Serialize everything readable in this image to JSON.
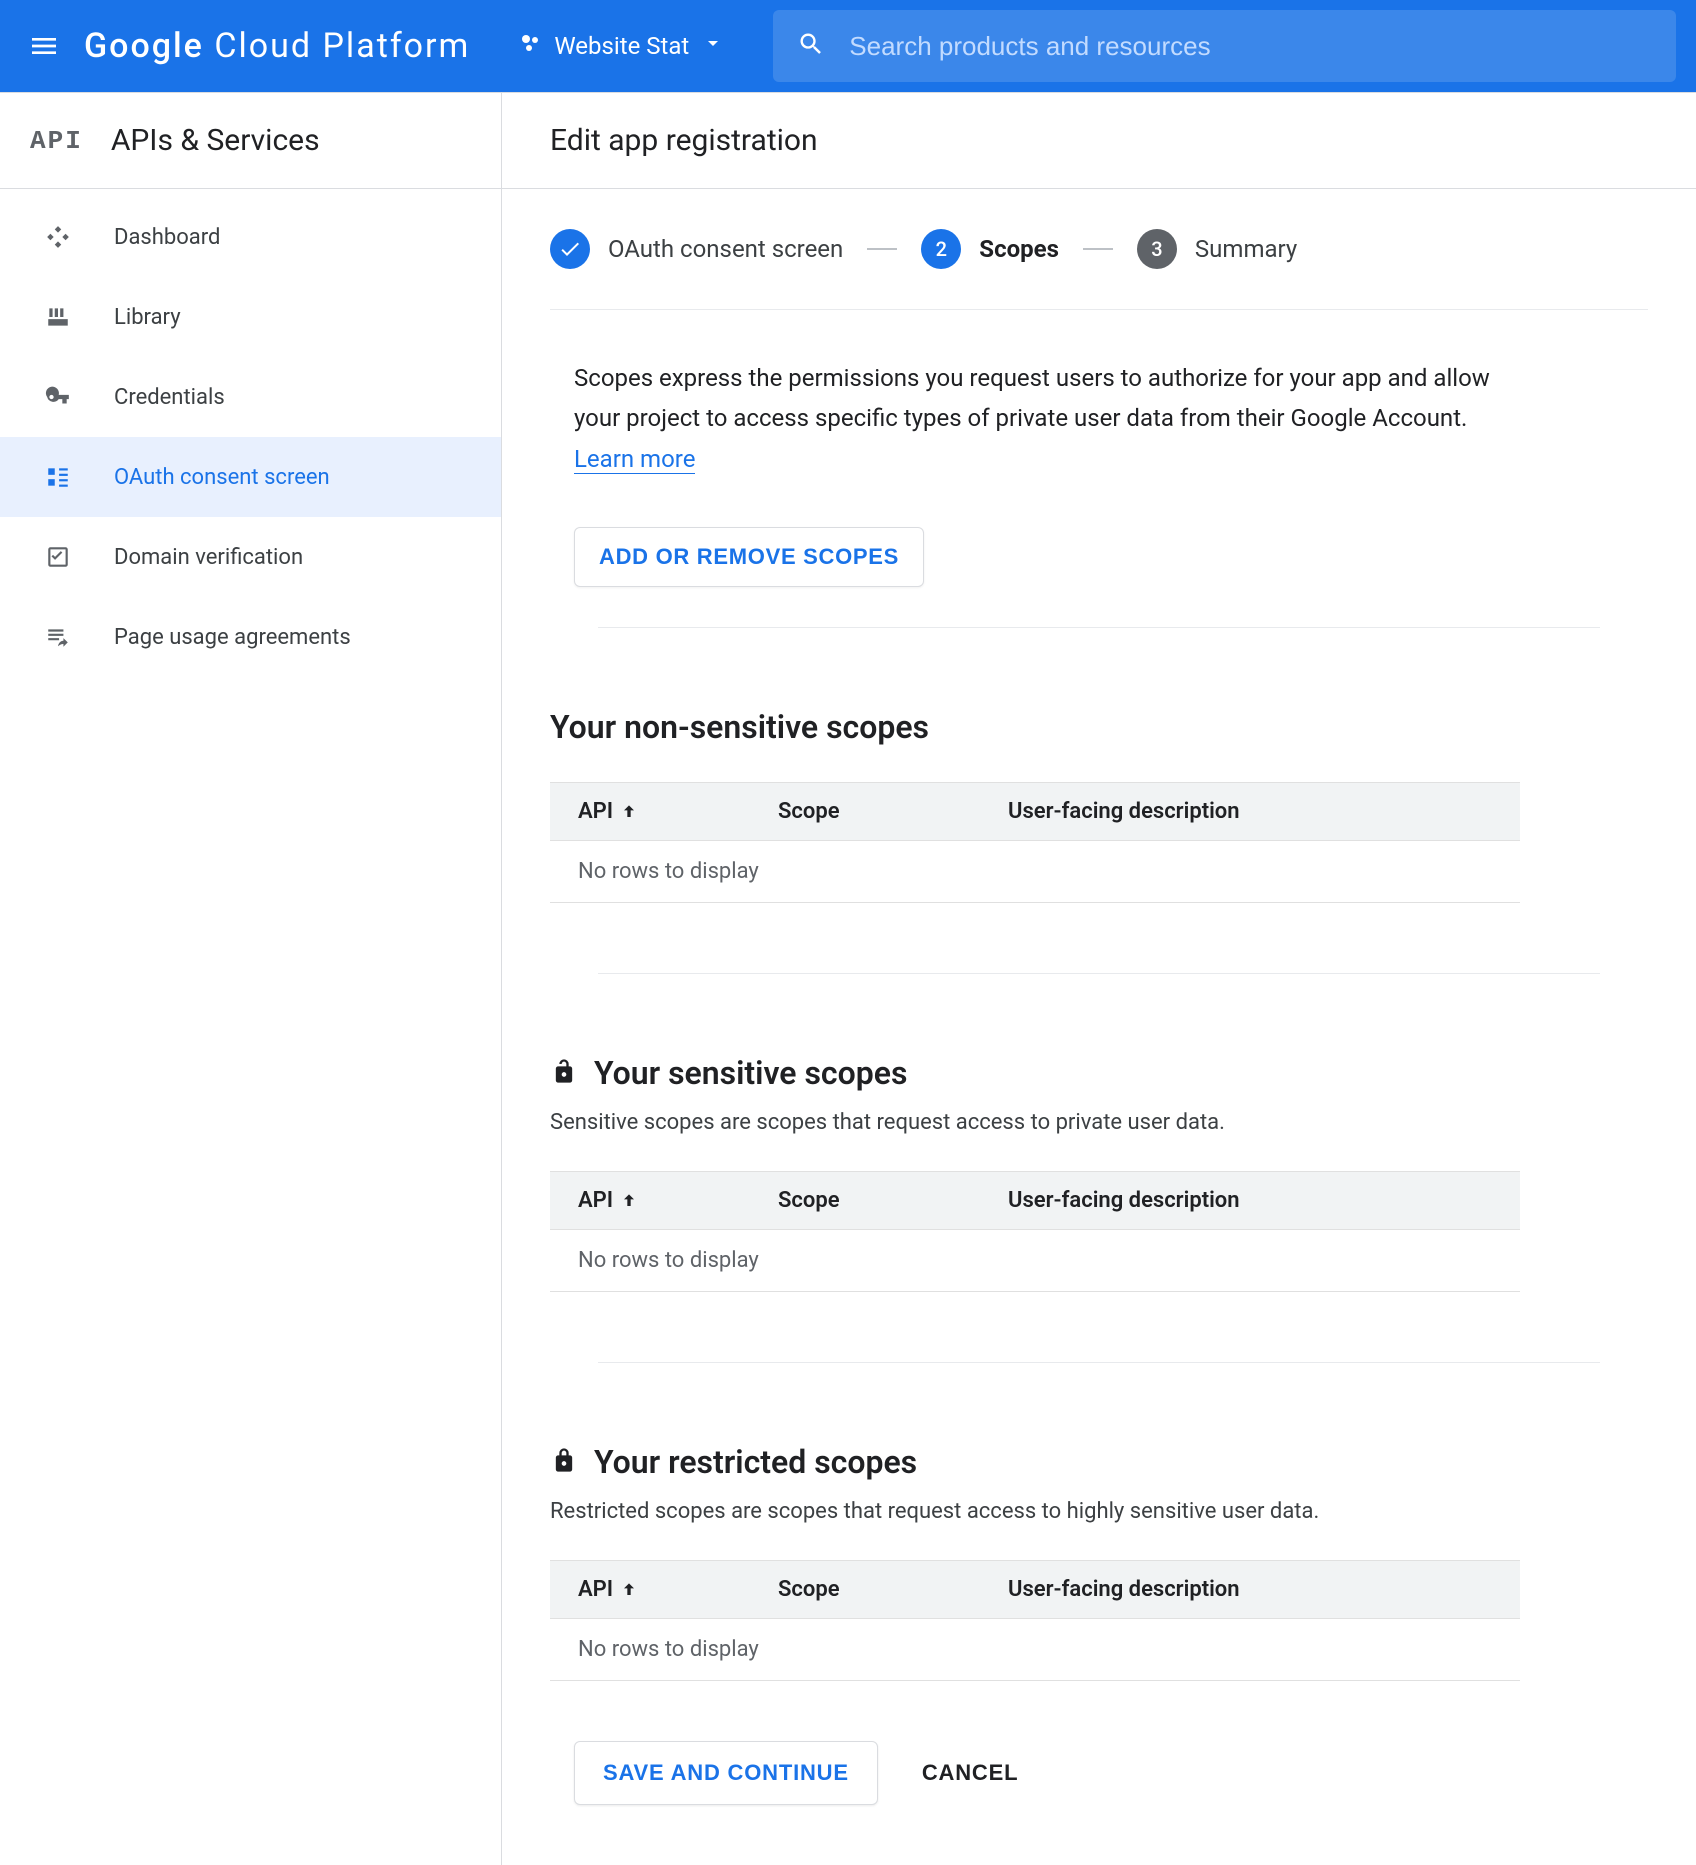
{
  "header": {
    "brand_prefix": "Google",
    "brand_rest": " Cloud Platform",
    "project_name": "Website Stat",
    "search_placeholder": "Search products and resources"
  },
  "sidebar": {
    "logo_text": "API",
    "title": "APIs & Services",
    "items": [
      {
        "icon": "dashboard",
        "label": "Dashboard"
      },
      {
        "icon": "library",
        "label": "Library"
      },
      {
        "icon": "key",
        "label": "Credentials"
      },
      {
        "icon": "consent",
        "label": "OAuth consent screen",
        "active": true
      },
      {
        "icon": "check",
        "label": "Domain verification"
      },
      {
        "icon": "agreements",
        "label": "Page usage agreements"
      }
    ]
  },
  "main": {
    "page_title": "Edit app registration",
    "stepper": {
      "step1": "OAuth consent screen",
      "step2_num": "2",
      "step2": "Scopes",
      "step3_num": "3",
      "step3": "Summary"
    },
    "intro": "Scopes express the permissions you request users to authorize for your app and allow your project to access specific types of private user data from their Google Account. ",
    "learn_more": "Learn more",
    "add_remove_btn": "ADD OR REMOVE SCOPES",
    "table_headers": {
      "api": "API",
      "scope": "Scope",
      "desc": "User-facing description"
    },
    "empty_row": "No rows to display",
    "sections": {
      "non_sensitive": {
        "title": "Your non-sensitive scopes"
      },
      "sensitive": {
        "title": "Your sensitive scopes",
        "desc": "Sensitive scopes are scopes that request access to private user data."
      },
      "restricted": {
        "title": "Your restricted scopes",
        "desc": "Restricted scopes are scopes that request access to highly sensitive user data."
      }
    },
    "buttons": {
      "save": "SAVE AND CONTINUE",
      "cancel": "CANCEL"
    }
  }
}
